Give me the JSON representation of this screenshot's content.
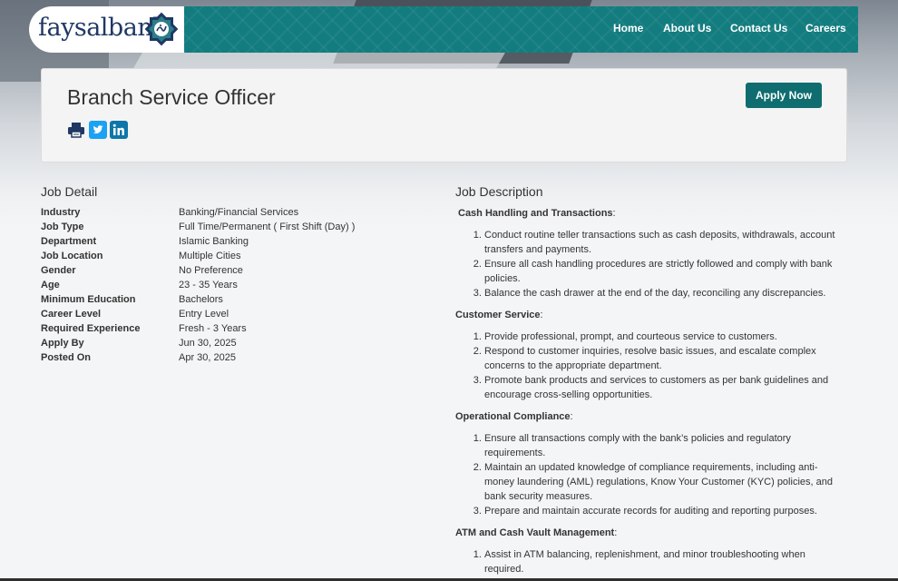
{
  "brand": {
    "name": "faysalbank",
    "logo_color": "#1f3864",
    "nav_color": "#137c7f",
    "accent": "#0f6d70"
  },
  "nav": {
    "home": "Home",
    "about": "About Us",
    "contact": "Contact Us",
    "careers": "Careers"
  },
  "job": {
    "title": "Branch Service Officer",
    "apply_label": "Apply Now",
    "share_icons": [
      "print-icon",
      "twitter-icon",
      "linkedin-icon"
    ]
  },
  "job_detail": {
    "heading": "Job Detail",
    "rows": [
      {
        "label": "Industry",
        "value": "Banking/Financial Services"
      },
      {
        "label": "Job Type",
        "value": "Full Time/Permanent ( First Shift (Day) )"
      },
      {
        "label": "Department",
        "value": "Islamic Banking"
      },
      {
        "label": "Job Location",
        "value": "Multiple Cities"
      },
      {
        "label": "Gender",
        "value": "No Preference"
      },
      {
        "label": "Age",
        "value": "23 - 35 Years"
      },
      {
        "label": "Minimum Education",
        "value": "Bachelors"
      },
      {
        "label": "Career Level",
        "value": "Entry Level"
      },
      {
        "label": "Required Experience",
        "value": "Fresh - 3 Years"
      },
      {
        "label": "Apply By",
        "value": "Jun 30, 2025"
      },
      {
        "label": "Posted On",
        "value": "Apr 30, 2025"
      }
    ]
  },
  "job_description": {
    "heading": "Job Description",
    "sections": [
      {
        "title": "Cash Handling and Transactions",
        "items": [
          "Conduct routine teller transactions such as cash deposits, withdrawals, account transfers and payments.",
          "Ensure all cash handling procedures are strictly followed and comply with bank policies.",
          "Balance the cash drawer at the end of the day, reconciling any discrepancies."
        ]
      },
      {
        "title": "Customer Service",
        "items": [
          "Provide professional, prompt, and courteous service to customers.",
          "Respond to customer inquiries, resolve basic issues, and escalate complex concerns to the appropriate department.",
          "Promote bank products and services to customers as per bank guidelines and encourage cross-selling opportunities."
        ]
      },
      {
        "title": "Operational Compliance",
        "items": [
          "Ensure all transactions comply with the bank’s policies and regulatory requirements.",
          "Maintain an updated knowledge of compliance requirements, including anti-money laundering (AML) regulations, Know Your Customer (KYC) policies, and bank security measures.",
          "Prepare and maintain accurate records for auditing and reporting purposes."
        ]
      },
      {
        "title": "ATM and Cash Vault Management",
        "items": [
          "Assist in ATM balancing, replenishment, and minor troubleshooting when required."
        ]
      }
    ]
  }
}
